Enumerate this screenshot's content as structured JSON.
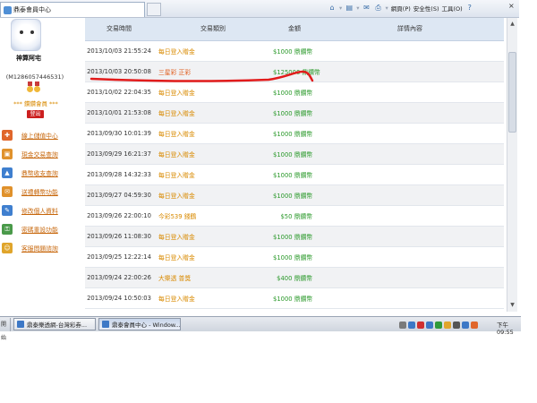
{
  "browser": {
    "tab_title": "鼎泰會員中心",
    "commands": [
      {
        "label": "網頁(P)",
        "icon": "page-icon"
      },
      {
        "label": "安全性(S)",
        "icon": "safety-icon"
      },
      {
        "label": "工具(O)",
        "icon": "tools-icon"
      }
    ],
    "close_glyph": "×"
  },
  "sidebar": {
    "user_name": "神算阿宅",
    "user_id": "(M1286057446531)",
    "member_level": "*** 鑽鑽會員 ***",
    "logout_label": "登出",
    "nav": [
      {
        "label": "線上儲值中心",
        "icon": "deposit-icon",
        "color": "#e0662b"
      },
      {
        "label": "現金交易查詢",
        "icon": "cash-ledger-icon",
        "color": "#e0912b"
      },
      {
        "label": "鼎幣收支查詢",
        "icon": "coin-chart-icon",
        "color": "#3f7fcf"
      },
      {
        "label": "送禮轉幣功能",
        "icon": "gift-icon",
        "color": "#e0912b"
      },
      {
        "label": "修改個人資料",
        "icon": "profile-edit-icon",
        "color": "#3f7fcf"
      },
      {
        "label": "密碼重設功能",
        "icon": "password-icon",
        "color": "#4a9a4a"
      },
      {
        "label": "客服問題諮詢",
        "icon": "support-icon",
        "color": "#e0a52b"
      }
    ]
  },
  "table": {
    "headers": [
      "交易時間",
      "交易類別",
      "金額",
      "詳情內容"
    ],
    "rows": [
      {
        "time": "2013/10/03 21:55:24",
        "type": "每日登入贈金",
        "amount": "$1000 鼎鑽幣",
        "highlight": false
      },
      {
        "time": "2013/10/03 20:50:08",
        "type": "三星彩 正彩",
        "amount": "$125000 鼎鑽幣",
        "highlight": true
      },
      {
        "time": "2013/10/02 22:04:35",
        "type": "每日登入贈金",
        "amount": "$1000 鼎鑽幣",
        "highlight": false
      },
      {
        "time": "2013/10/01 21:53:08",
        "type": "每日登入贈金",
        "amount": "$1000 鼎鑽幣",
        "highlight": false
      },
      {
        "time": "2013/09/30 10:01:39",
        "type": "每日登入贈金",
        "amount": "$1000 鼎鑽幣",
        "highlight": false
      },
      {
        "time": "2013/09/29 16:21:37",
        "type": "每日登入贈金",
        "amount": "$1000 鼎鑽幣",
        "highlight": false
      },
      {
        "time": "2013/09/28 14:32:33",
        "type": "每日登入贈金",
        "amount": "$1000 鼎鑽幣",
        "highlight": false
      },
      {
        "time": "2013/09/27 04:59:30",
        "type": "每日登入贈金",
        "amount": "$1000 鼎鑽幣",
        "highlight": false
      },
      {
        "time": "2013/09/26 22:00:10",
        "type": "今彩539 錢鶴",
        "amount": "$50 鼎鑽幣",
        "highlight": false
      },
      {
        "time": "2013/09/26 11:08:30",
        "type": "每日登入贈金",
        "amount": "$1000 鼎鑽幣",
        "highlight": false
      },
      {
        "time": "2013/09/25 12:22:14",
        "type": "每日登入贈金",
        "amount": "$1000 鼎鑽幣",
        "highlight": false
      },
      {
        "time": "2013/09/24 22:00:26",
        "type": "大樂透 普獎",
        "amount": "$400 鼎鑽幣",
        "highlight": false
      },
      {
        "time": "2013/09/24 10:50:03",
        "type": "每日登入贈金",
        "amount": "$1000 鼎鑽幣",
        "highlight": false
      }
    ]
  },
  "taskbar": {
    "start_label": "開始",
    "windows": [
      {
        "label": "鼎泰樂透網-台灣彩券...",
        "active": false
      },
      {
        "label": "鼎泰會員中心 - Window...",
        "active": true
      }
    ],
    "clock": "下午 09:55"
  },
  "colors": {
    "annotation": "#e21b1b",
    "header_bg": "#dde7f3",
    "amount_green": "#2c9a2c",
    "type_orange": "#d98a00"
  }
}
